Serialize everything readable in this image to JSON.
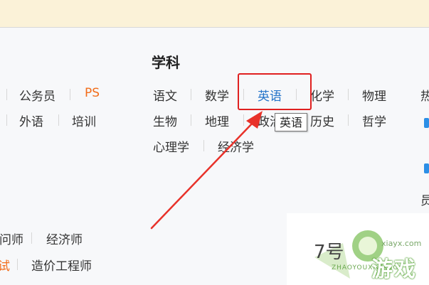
{
  "section": {
    "heading": "学科"
  },
  "left_links": {
    "civil_servant": "公务员",
    "ps": "PS",
    "foreign_language": "外语",
    "training": "培训",
    "partial_teacher": "问师",
    "economist": "经济师",
    "partial_exam": "试",
    "cost_engineer": "造价工程师"
  },
  "subjects": {
    "row1": [
      "语文",
      "数学",
      "英语",
      "化学",
      "物理"
    ],
    "row2": [
      "生物",
      "地理",
      "政治",
      "历史",
      "哲学"
    ],
    "row3": [
      "心理学",
      "经济学"
    ]
  },
  "tooltip": {
    "text": "英语"
  },
  "edge": {
    "partial1": "热",
    "partial2": "员"
  },
  "watermark": {
    "number": "7号",
    "site": "xiayx.com",
    "brand_sub": "ZHAOYOUXIWANG",
    "brand": "游戏"
  },
  "colors": {
    "highlight_red": "#e02020",
    "link_blue": "#2474c9",
    "accent_orange": "#f26d1a",
    "edge_blue": "#2c8fe6"
  },
  "icons": {
    "arrow": "red-pointer-arrow",
    "watermark_logo": "game-logo-icon"
  }
}
